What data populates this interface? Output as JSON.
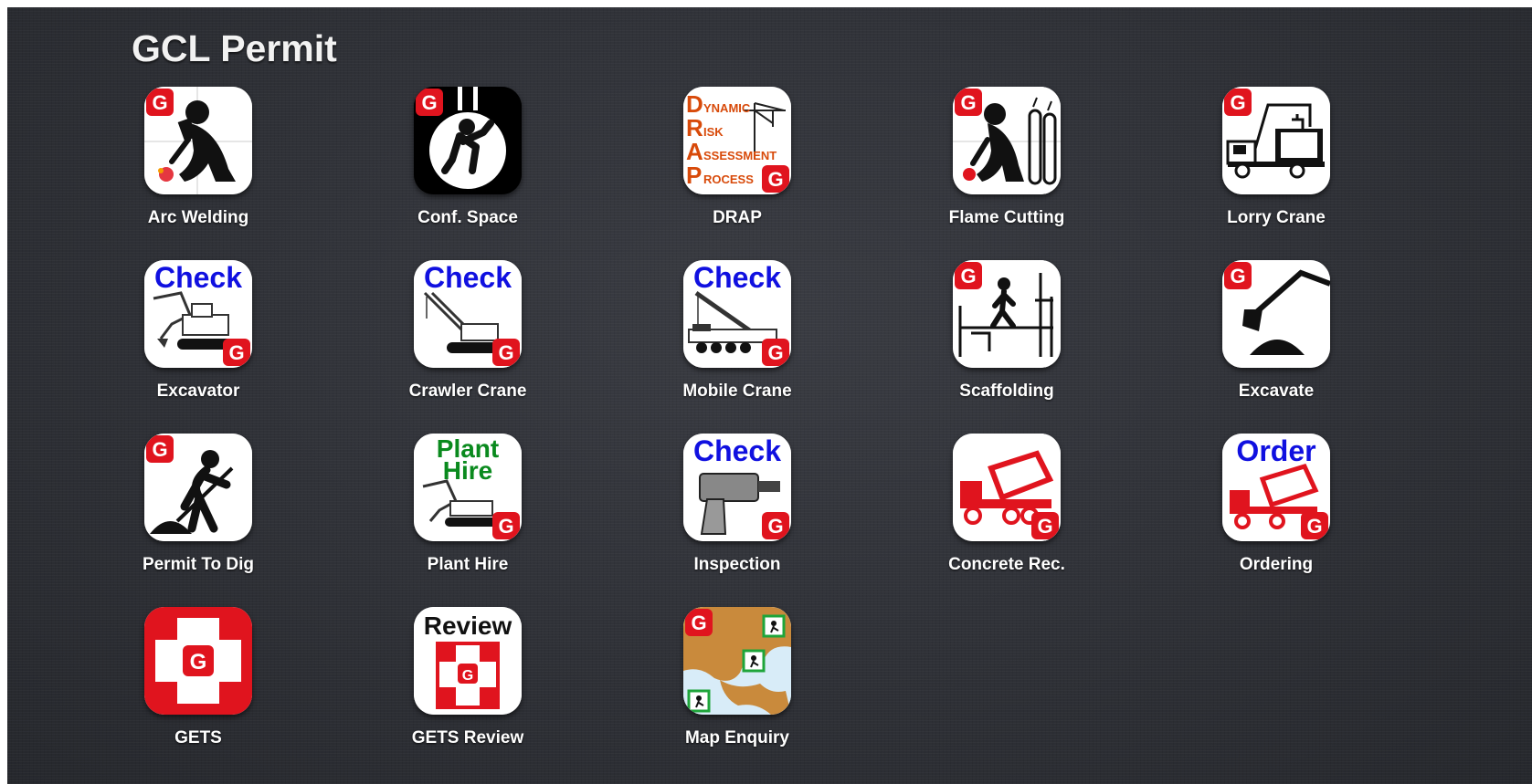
{
  "header": {
    "title": "GCL Permit"
  },
  "badge_letter": "G",
  "colors": {
    "brand_red": "#e0141e",
    "check_blue": "#1010e0",
    "plant_green": "#0a8a1e",
    "drap_orange": "#d84a0a",
    "map_land": "#c98a3c",
    "map_sea": "#d8ecf8"
  },
  "apps": [
    {
      "label": "Arc Welding",
      "icon": "arc-welding-icon"
    },
    {
      "label": "Conf. Space",
      "icon": "confined-space-icon"
    },
    {
      "label": "DRAP",
      "icon": "drap-icon",
      "icon_text": [
        "D",
        "YNAMIC",
        "R",
        "ISK",
        "A",
        "SSESSMENT",
        "P",
        "ROCESS"
      ]
    },
    {
      "label": "Flame Cutting",
      "icon": "flame-cutting-icon"
    },
    {
      "label": "Lorry Crane",
      "icon": "lorry-crane-icon"
    },
    {
      "label": "Excavator",
      "icon": "excavator-check-icon",
      "icon_text": "Check"
    },
    {
      "label": "Crawler Crane",
      "icon": "crawler-crane-check-icon",
      "icon_text": "Check"
    },
    {
      "label": "Mobile Crane",
      "icon": "mobile-crane-check-icon",
      "icon_text": "Check"
    },
    {
      "label": "Scaffolding",
      "icon": "scaffolding-icon"
    },
    {
      "label": "Excavate",
      "icon": "excavate-icon"
    },
    {
      "label": "Permit To Dig",
      "icon": "permit-to-dig-icon"
    },
    {
      "label": "Plant Hire",
      "icon": "plant-hire-icon",
      "icon_text": [
        "Plant",
        "Hire"
      ]
    },
    {
      "label": "Inspection",
      "icon": "inspection-check-icon",
      "icon_text": "Check"
    },
    {
      "label": "Concrete Rec.",
      "icon": "concrete-truck-icon"
    },
    {
      "label": "Ordering",
      "icon": "concrete-order-icon",
      "icon_text": "Order"
    },
    {
      "label": "GETS",
      "icon": "gets-icon"
    },
    {
      "label": "GETS Review",
      "icon": "gets-review-icon",
      "icon_text": "Review"
    },
    {
      "label": "Map Enquiry",
      "icon": "map-enquiry-icon"
    }
  ]
}
